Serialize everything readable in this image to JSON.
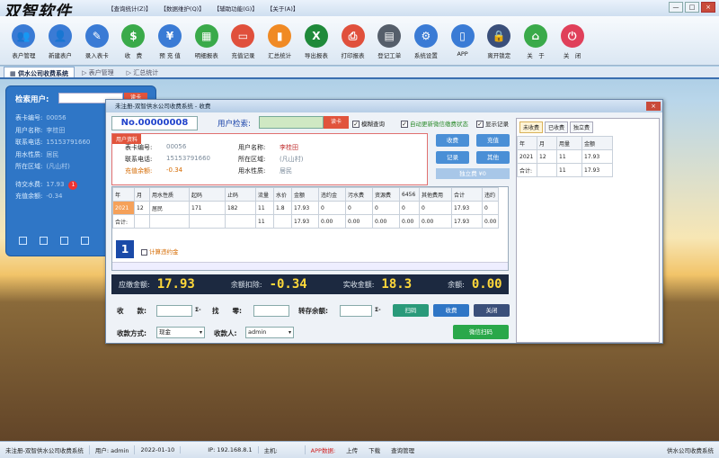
{
  "app": {
    "logo": "双智软件"
  },
  "menu": [
    "【查询统计(Z)】",
    "【数据维护(Q)】",
    "【辅助功能(G)】",
    "【关于(A)】"
  ],
  "window_buttons": [
    "—",
    "□",
    "×"
  ],
  "toolbar": [
    {
      "label": "表户管理",
      "icon": "users-icon",
      "color": "#3a7bd5",
      "glyph": "👥"
    },
    {
      "label": "新建表户",
      "icon": "add-user-icon",
      "color": "#3a7bd5",
      "glyph": "👤"
    },
    {
      "label": "录入表卡",
      "icon": "pen-icon",
      "color": "#3a7bd5",
      "glyph": "✎"
    },
    {
      "label": "收　费",
      "icon": "dollar-icon",
      "color": "#3aaa4a",
      "glyph": "$"
    },
    {
      "label": "预 充 值",
      "icon": "moneybag-icon",
      "color": "#3a7bd5",
      "glyph": "¥"
    },
    {
      "label": "明细报表",
      "icon": "sheet-icon",
      "color": "#3aaa4a",
      "glyph": "▦"
    },
    {
      "label": "充值记录",
      "icon": "card-icon",
      "color": "#e0503c",
      "glyph": "▭"
    },
    {
      "label": "汇总统计",
      "icon": "barchart-icon",
      "color": "#f08a24",
      "glyph": "▮"
    },
    {
      "label": "导出报表",
      "icon": "excel-icon",
      "color": "#1f8a3a",
      "glyph": "X"
    },
    {
      "label": "打印报表",
      "icon": "printer-icon",
      "color": "#e0503c",
      "glyph": "⎙"
    },
    {
      "label": "登记工单",
      "icon": "document-icon",
      "color": "#555e6a",
      "glyph": "▤"
    },
    {
      "label": "系统设置",
      "icon": "gear-icon",
      "color": "#3a7bd5",
      "glyph": "⚙"
    },
    {
      "label": "APP",
      "icon": "phone-icon",
      "color": "#3a7bd5",
      "glyph": "▯"
    },
    {
      "label": "离开锁定",
      "icon": "lock-icon",
      "color": "#3a4f7a",
      "glyph": "🔒"
    },
    {
      "label": "关　于",
      "icon": "home-icon",
      "color": "#3aaa4a",
      "glyph": "⌂"
    },
    {
      "label": "关　闭",
      "icon": "power-icon",
      "color": "#e0405a",
      "glyph": "⏻"
    }
  ],
  "tabs": [
    "▦ 供水公司收费系统",
    "▷ 表户管理",
    "▷ 汇总统计"
  ],
  "left": {
    "search_label": "检索用户:",
    "search_btn": "读卡",
    "rows": [
      {
        "k": "表卡编号:",
        "v": "00056"
      },
      {
        "k": "用户名称:",
        "v": "李桂田"
      },
      {
        "k": "联系电话:",
        "v": "15153791660"
      },
      {
        "k": "用水性质:",
        "v": "居民"
      },
      {
        "k": "所在区域:",
        "v": "(凡山村)"
      }
    ],
    "owed_label": "待交水费:",
    "owed": "17.93",
    "owed_count": "1",
    "balance_label": "充值余额:",
    "balance": "-0.34"
  },
  "dialog": {
    "title": "未注册-双智供水公司收费系统 - 收费",
    "close": "×",
    "card_no": "No.00000008",
    "search_label": "用户检索:",
    "read_card": "读卡",
    "checks": [
      {
        "label": "模糊查询",
        "checked": "✓"
      },
      {
        "label": "自动更新微信缴费状态",
        "checked": "✓"
      },
      {
        "label": "显示记录",
        "checked": "✓"
      }
    ],
    "info_head": "用户资料",
    "info": {
      "card_k": "表卡编号:",
      "card_v": "00056",
      "name_k": "用户名称:",
      "name_v": "李桂田",
      "phone_k": "联系电话:",
      "phone_v": "15153791660",
      "area_k": "所在区域:",
      "area_v": "(凡山村)",
      "bal_k": "充值余额:",
      "bal_v": "-0.34",
      "type_k": "用水性质:",
      "type_v": "居民"
    },
    "buttons": {
      "charge": "收费",
      "recharge": "充值",
      "record": "记录",
      "other": "其他",
      "single": "独立费 ¥0"
    },
    "grid_headers": [
      "年",
      "月",
      "用水性质",
      "起码",
      "止码",
      "流量",
      "水价",
      "金额",
      "违约金",
      "污水费",
      "资源费",
      "6456",
      "其他费用",
      "合计",
      "违约"
    ],
    "grid_rows": [
      [
        "2021",
        "12",
        "居民",
        "171",
        "182",
        "11",
        "1.8",
        "17.93",
        "0",
        "0",
        "0",
        "0",
        "0",
        "17.93",
        "0"
      ],
      [
        "合计:",
        "",
        "",
        "",
        "",
        "11",
        "",
        "17.93",
        "0.00",
        "0.00",
        "0.00",
        "0.00",
        "0.00",
        "17.93",
        "0.00"
      ]
    ],
    "page_num": "1",
    "calc_late": "计算违约金",
    "right_tabs": [
      "未收费",
      "已收费",
      "独立费"
    ],
    "right_headers": [
      "年",
      "月",
      "用量",
      "金额"
    ],
    "right_rows": [
      [
        "2021",
        "12",
        "11",
        "17.93"
      ],
      [
        "合计:",
        "",
        "11",
        "17.93"
      ]
    ],
    "totals": {
      "due_label": "应缴金额:",
      "due": "17.93",
      "deduct_label": "余额扣除:",
      "deduct": "-0.34",
      "actual_label": "实收金额:",
      "actual": "18.3",
      "remain_label": "余额:",
      "remain": "0.00"
    },
    "pay": {
      "receive_label": "收　　款:",
      "change_label": "找　　零:",
      "deposit_label": "转存余额:",
      "sigma": "Σ-",
      "scan": "扫码",
      "charge": "收费",
      "close": "关闭",
      "method_label": "收款方式:",
      "method": "现金",
      "payee_label": "收款人:",
      "payee": "admin",
      "wechat": "微信扫码"
    }
  },
  "status": [
    "未注册-双智供水公司收费系统",
    "用户: admin",
    "2022-01-10",
    "IP: 192.168.8.1",
    "主机:",
    "APP数据:",
    "上传",
    "下载",
    "查询管理",
    "供水公司收费系统"
  ]
}
